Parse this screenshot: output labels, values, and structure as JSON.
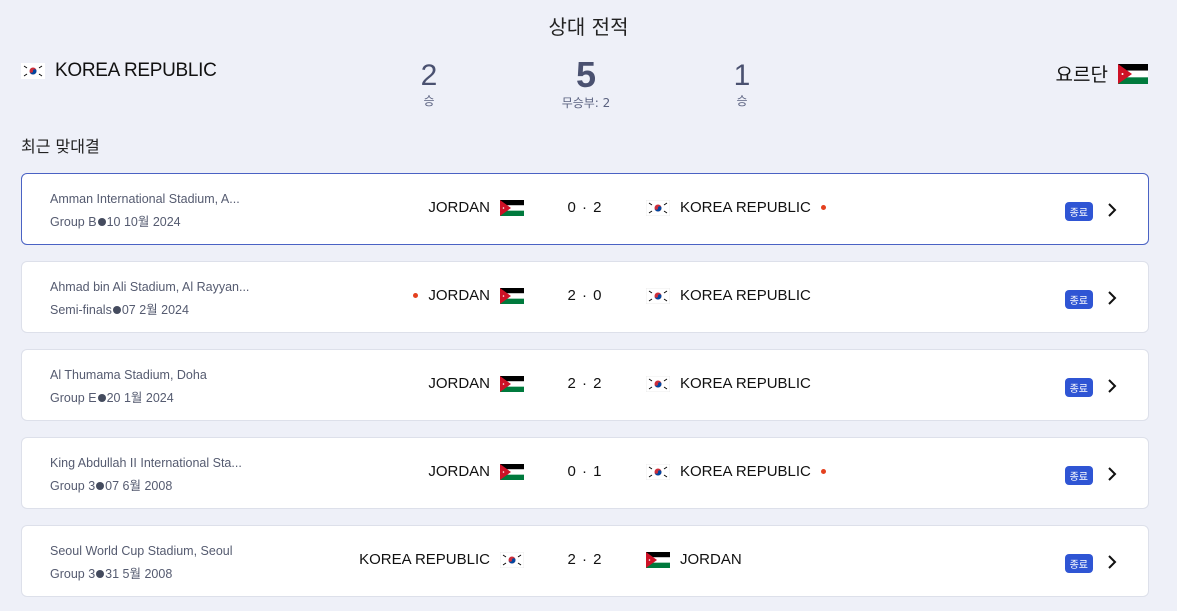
{
  "page": {
    "title": "상대 전적",
    "recent_label": "최근 맞대결"
  },
  "summary": {
    "team_left": {
      "name": "KOREA REPUBLIC",
      "flag": "korea-flag-icon"
    },
    "team_right": {
      "name": "요르단",
      "flag": "jordan-flag-icon"
    },
    "left_wins": "2",
    "left_wins_label": "승",
    "total": "5",
    "draws_label": "무승부: 2",
    "right_wins": "1",
    "right_wins_label": "승"
  },
  "matches": [
    {
      "venue": "Amman International Stadium, A...",
      "stage": "Group B",
      "date": "10 10월 2024",
      "home": "JORDAN",
      "score": "0 · 2",
      "away": "KOREA REPUBLIC",
      "winner": "away",
      "status": "종료"
    },
    {
      "venue": "Ahmad bin Ali Stadium, Al Rayyan...",
      "stage": "Semi-finals",
      "date": "07 2월 2024",
      "home": "JORDAN",
      "score": "2 · 0",
      "away": "KOREA REPUBLIC",
      "winner": "home",
      "status": "종료"
    },
    {
      "venue": "Al Thumama Stadium, Doha",
      "stage": "Group E",
      "date": "20 1월 2024",
      "home": "JORDAN",
      "score": "2 · 2",
      "away": "KOREA REPUBLIC",
      "winner": "none",
      "status": "종료"
    },
    {
      "venue": "King Abdullah II International Sta...",
      "stage": "Group 3",
      "date": "07 6월 2008",
      "home": "JORDAN",
      "score": "0 · 1",
      "away": "KOREA REPUBLIC",
      "winner": "away",
      "status": "종료"
    },
    {
      "venue": "Seoul World Cup Stadium, Seoul",
      "stage": "Group 3",
      "date": "31 5월 2008",
      "home": "KOREA REPUBLIC",
      "score": "2 · 2",
      "away": "JORDAN",
      "winner": "none",
      "status": "종료"
    }
  ],
  "colors": {
    "accent": "#2f55d4",
    "win_dot": "#e4401e",
    "active_border": "#4a62c4"
  }
}
